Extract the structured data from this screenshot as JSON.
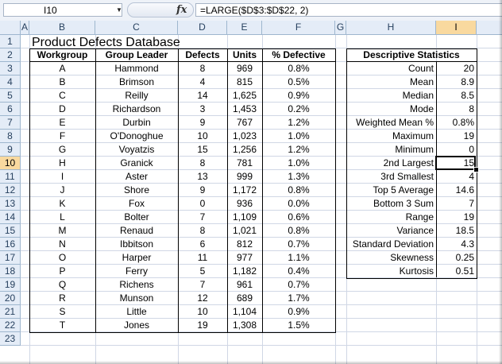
{
  "formula_bar": {
    "name_box": "I10",
    "fx_label": "fx",
    "formula": "=LARGE($D$3:$D$22, 2)"
  },
  "columns": [
    "A",
    "B",
    "C",
    "D",
    "E",
    "F",
    "G",
    "H",
    "I"
  ],
  "active_column": "I",
  "active_row": 10,
  "rows": [
    "1",
    "2",
    "3",
    "4",
    "5",
    "6",
    "7",
    "8",
    "9",
    "10",
    "11",
    "12",
    "13",
    "14",
    "15",
    "16",
    "17",
    "18",
    "19",
    "20",
    "21",
    "22",
    "23"
  ],
  "title": "Product Defects Database",
  "table": {
    "headers": [
      "Workgroup",
      "Group Leader",
      "Defects",
      "Units",
      "% Defective"
    ],
    "rows": [
      [
        "A",
        "Hammond",
        "8",
        "969",
        "0.8%"
      ],
      [
        "B",
        "Brimson",
        "4",
        "815",
        "0.5%"
      ],
      [
        "C",
        "Reilly",
        "14",
        "1,625",
        "0.9%"
      ],
      [
        "D",
        "Richardson",
        "3",
        "1,453",
        "0.2%"
      ],
      [
        "E",
        "Durbin",
        "9",
        "767",
        "1.2%"
      ],
      [
        "F",
        "O'Donoghue",
        "10",
        "1,023",
        "1.0%"
      ],
      [
        "G",
        "Voyatzis",
        "15",
        "1,256",
        "1.2%"
      ],
      [
        "H",
        "Granick",
        "8",
        "781",
        "1.0%"
      ],
      [
        "I",
        "Aster",
        "13",
        "999",
        "1.3%"
      ],
      [
        "J",
        "Shore",
        "9",
        "1,172",
        "0.8%"
      ],
      [
        "K",
        "Fox",
        "0",
        "936",
        "0.0%"
      ],
      [
        "L",
        "Bolter",
        "7",
        "1,109",
        "0.6%"
      ],
      [
        "M",
        "Renaud",
        "8",
        "1,021",
        "0.8%"
      ],
      [
        "N",
        "Ibbitson",
        "6",
        "812",
        "0.7%"
      ],
      [
        "O",
        "Harper",
        "11",
        "977",
        "1.1%"
      ],
      [
        "P",
        "Ferry",
        "5",
        "1,182",
        "0.4%"
      ],
      [
        "Q",
        "Richens",
        "7",
        "961",
        "0.7%"
      ],
      [
        "R",
        "Munson",
        "12",
        "689",
        "1.7%"
      ],
      [
        "S",
        "Little",
        "10",
        "1,104",
        "0.9%"
      ],
      [
        "T",
        "Jones",
        "19",
        "1,308",
        "1.5%"
      ]
    ]
  },
  "stats": {
    "header": "Descriptive Statistics",
    "rows": [
      [
        "Count",
        "20"
      ],
      [
        "Mean",
        "8.9"
      ],
      [
        "Median",
        "8.5"
      ],
      [
        "Mode",
        "8"
      ],
      [
        "Weighted Mean %",
        "0.8%"
      ],
      [
        "Maximum",
        "19"
      ],
      [
        "Minimum",
        "0"
      ],
      [
        "2nd Largest",
        "15"
      ],
      [
        "3rd Smallest",
        "4"
      ],
      [
        "Top 5 Average",
        "14.6"
      ],
      [
        "Bottom 3 Sum",
        "7"
      ],
      [
        "Range",
        "19"
      ],
      [
        "Variance",
        "18.5"
      ],
      [
        "Standard Deviation",
        "4.3"
      ],
      [
        "Skewness",
        "0.25"
      ],
      [
        "Kurtosis",
        "0.51"
      ]
    ]
  }
}
